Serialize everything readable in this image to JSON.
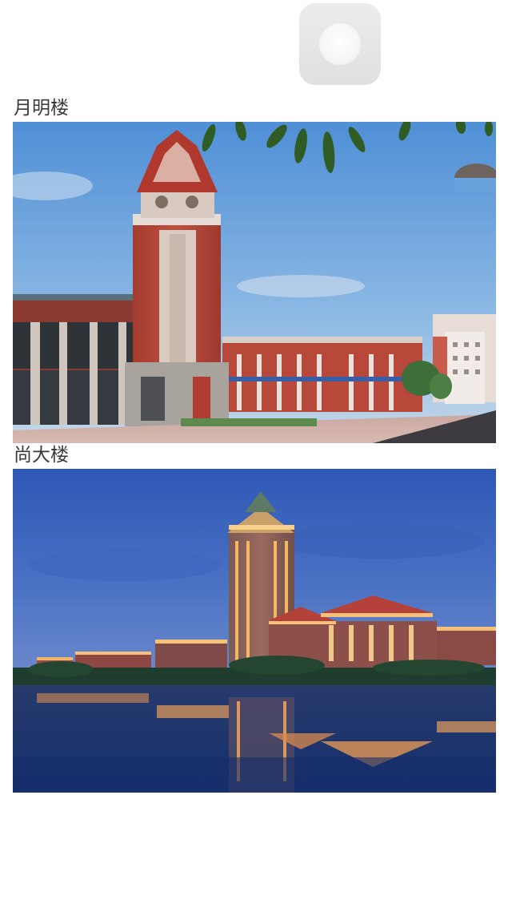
{
  "header": {
    "icon": "blank-rounded-square-icon"
  },
  "sections": [
    {
      "caption": "月明楼",
      "image": "clock-tower-campus-photo"
    },
    {
      "caption": "尚大楼",
      "image": "night-lake-building-photo"
    }
  ],
  "colors": {
    "background": "#ffffff",
    "caption_text": "#3a3a3a",
    "sky_day": "#6aa3dc",
    "sky_night": "#3d63b8",
    "brick": "#b4473a"
  }
}
